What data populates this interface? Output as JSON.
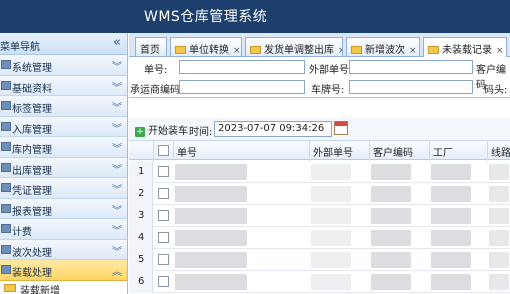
{
  "app": {
    "title": "WMS仓库管理系统"
  },
  "sidebar": {
    "header": "菜单导航",
    "collapse_symbol": "«",
    "items": [
      {
        "label": "系统管理"
      },
      {
        "label": "基础资料"
      },
      {
        "label": "标签管理"
      },
      {
        "label": "入库管理"
      },
      {
        "label": "库内管理"
      },
      {
        "label": "出库管理"
      },
      {
        "label": "凭证管理"
      },
      {
        "label": "报表管理"
      },
      {
        "label": "计费"
      },
      {
        "label": "波次处理"
      },
      {
        "label": "装载处理"
      }
    ],
    "sub_items": [
      {
        "label": "装载新增"
      }
    ],
    "expand_symbol": "︾",
    "collapse_up_symbol": "︽"
  },
  "tabs": [
    {
      "label": "首页",
      "close": ""
    },
    {
      "label": "单位转换",
      "close": "×"
    },
    {
      "label": "发货单调整出库",
      "close": "×"
    },
    {
      "label": "新增波次",
      "close": "×"
    },
    {
      "label": "未装载记录",
      "close": "×"
    }
  ],
  "form": {
    "order_no_label": "单号:",
    "order_no_value": "",
    "external_no_label": "外部单号:",
    "external_no_value": "",
    "customer_code_label": "客户编码",
    "carrier_code_label": "承运商编码:",
    "carrier_code_value": "",
    "plate_no_label": "车牌号:",
    "plate_no_value": "",
    "dock_label": "码头:"
  },
  "toolbar": {
    "start_loading_label": "开始装车",
    "plus_symbol": "+",
    "time_label": "时间:",
    "time_value": "2023-07-07 09:34:26"
  },
  "table": {
    "headers": [
      "单号",
      "外部单号",
      "客户编码",
      "工厂",
      "线路"
    ],
    "row_numbers": [
      "1",
      "2",
      "3",
      "4",
      "5",
      "6"
    ]
  },
  "colors": {
    "topbar": "#1d3f6e",
    "active_menu": "#ffd664",
    "accent_green": "#3bab4a"
  }
}
